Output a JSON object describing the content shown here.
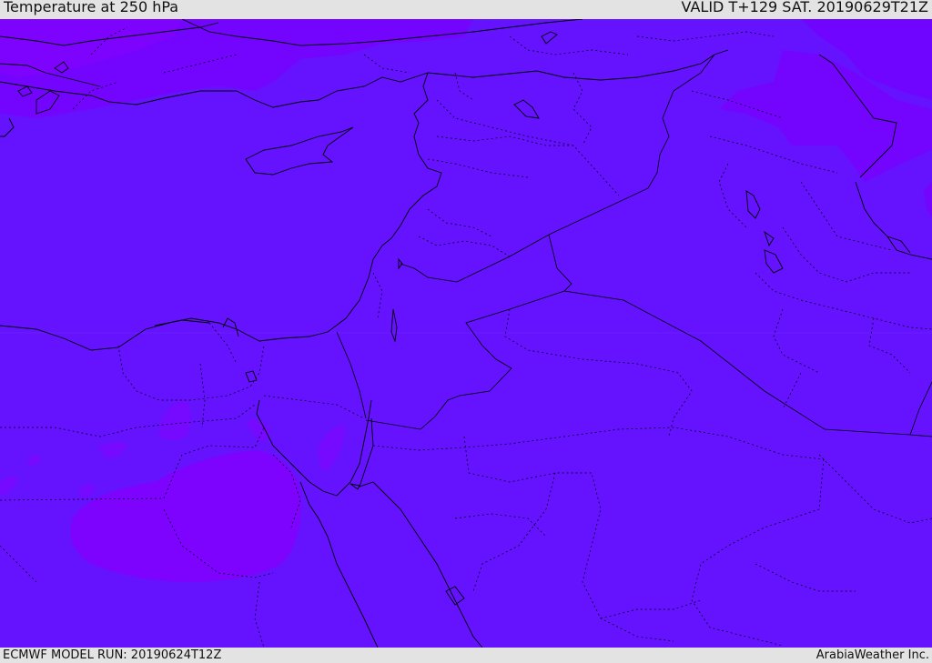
{
  "header": {
    "title": "Temperature at 250 hPa",
    "valid": "VALID T+129 SAT. 20190629T21Z"
  },
  "footer": {
    "model_run": "ECMWF MODEL RUN: 20190624T12Z",
    "credit": "ArabiaWeather Inc."
  },
  "colors": {
    "base_fill": "#6512ff",
    "warm_patch": "#7d03ff",
    "mid_patch": "#7109ff",
    "coastline": "#000000",
    "header_bg": "#e3e3e3"
  }
}
